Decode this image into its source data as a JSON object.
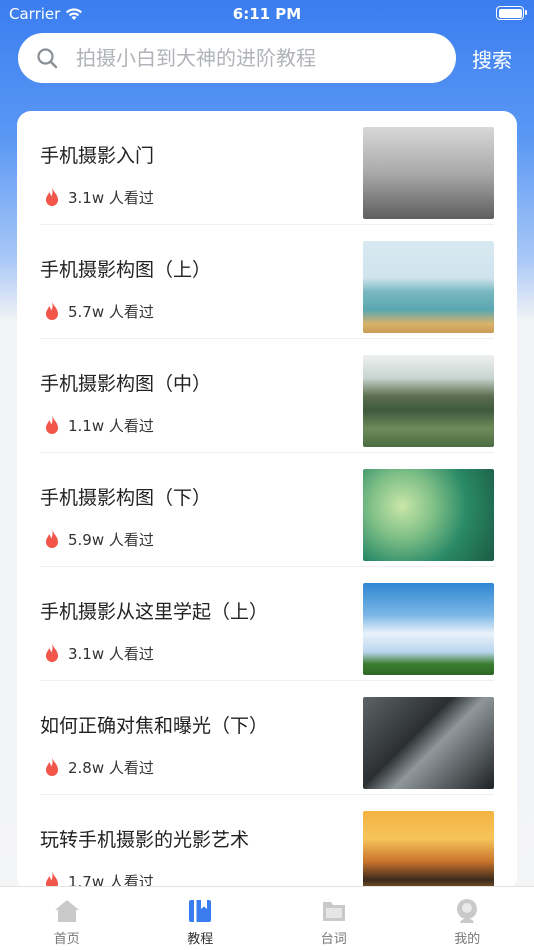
{
  "status_bar": {
    "carrier": "Carrier",
    "time": "6:11 PM"
  },
  "search": {
    "placeholder": "拍摄小白到大神的进阶教程",
    "button_label": "搜索"
  },
  "courses": [
    {
      "title": "手机摄影入门",
      "views": "3.1w 人看过"
    },
    {
      "title": "手机摄影构图（上）",
      "views": "5.7w 人看过"
    },
    {
      "title": "手机摄影构图（中）",
      "views": "1.1w 人看过"
    },
    {
      "title": "手机摄影构图（下）",
      "views": "5.9w 人看过"
    },
    {
      "title": "手机摄影从这里学起（上）",
      "views": "3.1w 人看过"
    },
    {
      "title": "如何正确对焦和曝光（下）",
      "views": "2.8w 人看过"
    },
    {
      "title": "玩转手机摄影的光影艺术",
      "views": "1.7w 人看过"
    }
  ],
  "tab_bar": {
    "tabs": [
      {
        "label": "首页",
        "icon": "home-icon",
        "active": false
      },
      {
        "label": "教程",
        "icon": "book-icon",
        "active": true
      },
      {
        "label": "台词",
        "icon": "folder-icon",
        "active": false
      },
      {
        "label": "我的",
        "icon": "profile-icon",
        "active": false
      }
    ]
  },
  "colors": {
    "accent": "#3a7df0",
    "fire": "#f2564a",
    "tab_inactive": "#c9c9c9"
  }
}
